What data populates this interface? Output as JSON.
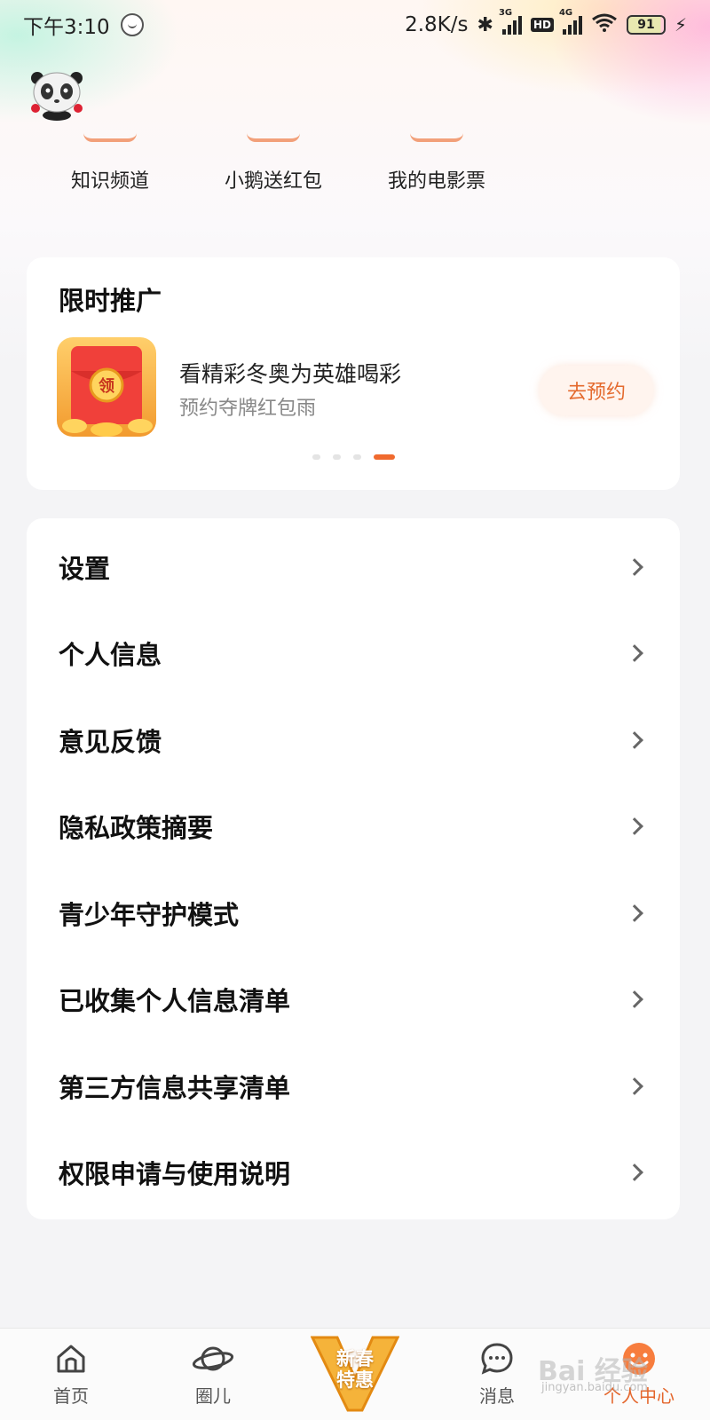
{
  "status_bar": {
    "time": "下午3:10",
    "net_speed": "2.8K/s",
    "sim1_tag": "3G",
    "hd_label": "HD",
    "sim2_tag": "4G",
    "battery": "91"
  },
  "quick_actions": [
    {
      "label": "知识频道"
    },
    {
      "label": "小鹅送红包"
    },
    {
      "label": "我的电影票"
    }
  ],
  "promo": {
    "section_title": "限时推广",
    "image_badge": "领",
    "headline": "看精彩冬奥为英雄喝彩",
    "subtitle": "预约夺牌红包雨",
    "button_label": "去预约",
    "carousel": {
      "count": 4,
      "active_index": 3
    }
  },
  "menu": {
    "items": [
      {
        "label": "设置"
      },
      {
        "label": "个人信息"
      },
      {
        "label": "意见反馈"
      },
      {
        "label": "隐私政策摘要"
      },
      {
        "label": "青少年守护模式"
      },
      {
        "label": "已收集个人信息清单"
      },
      {
        "label": "第三方信息共享清单"
      },
      {
        "label": "权限申请与使用说明"
      }
    ]
  },
  "bottom_nav": {
    "items": [
      {
        "label": "首页",
        "icon": "home-icon"
      },
      {
        "label": "圈儿",
        "icon": "planet-icon"
      },
      {
        "label": "消息",
        "icon": "message-icon"
      },
      {
        "label": "个人中心",
        "icon": "smiley-icon",
        "active": true
      }
    ],
    "promo_line1": "新春",
    "promo_line2": "特惠"
  },
  "watermark": {
    "text": "Bai 经验",
    "sub": "jingyan.baidu.com"
  },
  "colors": {
    "accent": "#f06a2e",
    "button_text": "#e46a2e",
    "button_bg": "#fff4ee",
    "page_bg": "#f4f4f6"
  }
}
